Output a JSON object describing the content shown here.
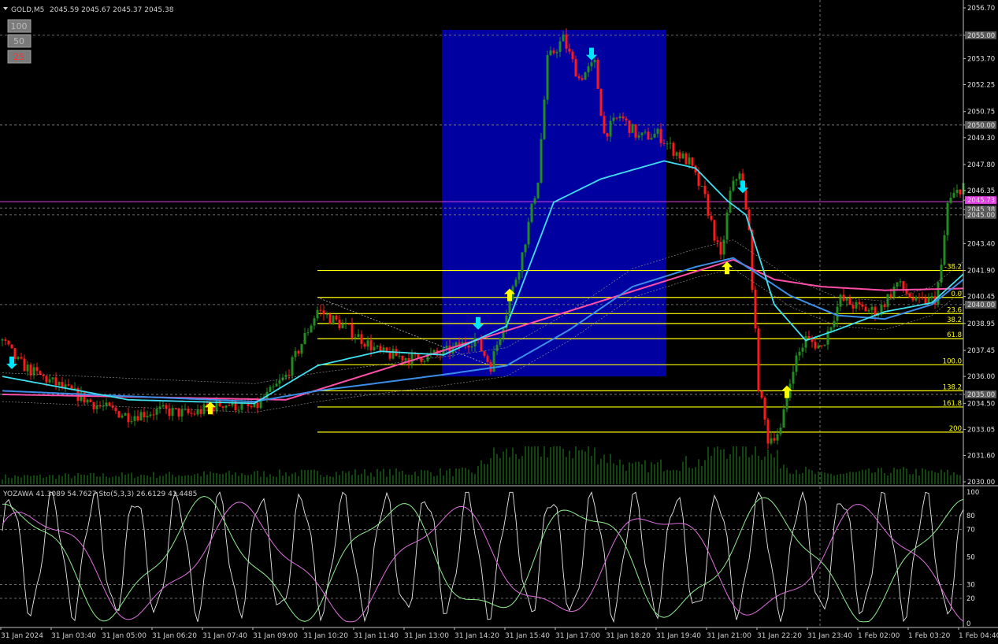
{
  "main_header": {
    "symbol": "GOLD,M5",
    "ohlc": "2045.59 2045.67 2045.37 2045.38"
  },
  "zoom_buttons": [
    {
      "label": "100"
    },
    {
      "label": "50"
    },
    {
      "label": "25"
    }
  ],
  "sub_header": {
    "text": "YOZAWA 41.3089 54.7627  Sto(5,3,3) 26.6129 41.4485"
  },
  "colors": {
    "bull": "#228b22",
    "bear": "#ff1a1a",
    "ma_fast": "#40e0f0",
    "ma_mid": "#3a8ee8",
    "ma_slow": "#ff4fa8",
    "fib": "#ffff00",
    "box": "#0000a0",
    "current": "#e040e0",
    "arrow_up": "#ffff00",
    "arrow_down": "#00e5ff"
  },
  "chart_data": {
    "type": "candlestick",
    "price_axis": {
      "min": 2030.0,
      "max": 2056.7,
      "ticks": [
        "2056.70",
        "2055.00",
        "2053.70",
        "2052.25",
        "2050.75",
        "2050.00",
        "2049.30",
        "2047.80",
        "2046.35",
        "2045.73",
        "2045.38",
        "2045.00",
        "2043.40",
        "2041.90",
        "2040.45",
        "2040.00",
        "2038.95",
        "2037.45",
        "2036.00",
        "2035.00",
        "2034.50",
        "2033.05",
        "2031.60",
        "2030.00"
      ],
      "highlight_ticks": [
        "2055.00",
        "2050.00",
        "2045.73",
        "2045.38",
        "2045.00",
        "2040.00",
        "2035.00"
      ]
    },
    "time_labels": [
      "31 Jan 2024",
      "31 Jan 03:40",
      "31 Jan 05:00",
      "31 Jan 06:20",
      "31 Jan 07:40",
      "31 Jan 09:00",
      "31 Jan 10:20",
      "31 Jan 11:40",
      "31 Jan 13:00",
      "31 Jan 14:20",
      "31 Jan 15:40",
      "31 Jan 17:00",
      "31 Jan 18:20",
      "31 Jan 19:40",
      "31 Jan 21:00",
      "31 Jan 22:20",
      "31 Jan 23:40",
      "1 Feb 02:00",
      "1 Feb 03:20",
      "1 Feb 04:40"
    ],
    "price_anchors": [
      [
        0,
        2038.0
      ],
      [
        5,
        2036.8
      ],
      [
        10,
        2036.2
      ],
      [
        20,
        2035.3
      ],
      [
        30,
        2034.4
      ],
      [
        40,
        2033.8
      ],
      [
        50,
        2034.1
      ],
      [
        60,
        2033.9
      ],
      [
        70,
        2034.5
      ],
      [
        80,
        2034.2
      ],
      [
        90,
        2036.0
      ],
      [
        100,
        2039.7
      ],
      [
        110,
        2038.6
      ],
      [
        120,
        2037.3
      ],
      [
        130,
        2037.0
      ],
      [
        140,
        2037.3
      ],
      [
        150,
        2038.1
      ],
      [
        155,
        2036.6
      ],
      [
        160,
        2039.6
      ],
      [
        165,
        2042.8
      ],
      [
        170,
        2047.0
      ],
      [
        173,
        2053.6
      ],
      [
        178,
        2054.8
      ],
      [
        183,
        2052.6
      ],
      [
        188,
        2053.4
      ],
      [
        191,
        2049.5
      ],
      [
        196,
        2050.5
      ],
      [
        202,
        2049.3
      ],
      [
        208,
        2049.5
      ],
      [
        213,
        2048.6
      ],
      [
        218,
        2047.9
      ],
      [
        223,
        2045.9
      ],
      [
        228,
        2042.5
      ],
      [
        231,
        2046.2
      ],
      [
        234,
        2047.5
      ],
      [
        237,
        2044.0
      ],
      [
        240,
        2035.5
      ],
      [
        243,
        2032.5
      ],
      [
        247,
        2033.0
      ],
      [
        251,
        2036.6
      ],
      [
        255,
        2038.1
      ],
      [
        260,
        2037.6
      ],
      [
        266,
        2040.3
      ],
      [
        272,
        2039.8
      ],
      [
        278,
        2039.6
      ],
      [
        284,
        2041.2
      ],
      [
        290,
        2040.1
      ],
      [
        296,
        2040.3
      ],
      [
        298,
        2042.0
      ],
      [
        300,
        2045.6
      ],
      [
        305,
        2046.7
      ]
    ],
    "ma_fast": [
      [
        0,
        2036.0
      ],
      [
        40,
        2034.7
      ],
      [
        80,
        2034.5
      ],
      [
        100,
        2036.6
      ],
      [
        120,
        2037.4
      ],
      [
        140,
        2037.2
      ],
      [
        160,
        2038.8
      ],
      [
        175,
        2045.7
      ],
      [
        190,
        2047.0
      ],
      [
        210,
        2048.0
      ],
      [
        220,
        2047.6
      ],
      [
        230,
        2045.8
      ],
      [
        236,
        2045.0
      ],
      [
        245,
        2040.0
      ],
      [
        255,
        2038.0
      ],
      [
        265,
        2038.6
      ],
      [
        280,
        2039.6
      ],
      [
        295,
        2040.1
      ],
      [
        305,
        2041.7
      ]
    ],
    "ma_mid": [
      [
        0,
        2035.2
      ],
      [
        40,
        2034.9
      ],
      [
        80,
        2034.6
      ],
      [
        100,
        2035.2
      ],
      [
        140,
        2036.1
      ],
      [
        160,
        2036.6
      ],
      [
        180,
        2038.6
      ],
      [
        200,
        2041.0
      ],
      [
        220,
        2042.1
      ],
      [
        232,
        2042.6
      ],
      [
        250,
        2040.5
      ],
      [
        265,
        2039.4
      ],
      [
        280,
        2039.2
      ],
      [
        295,
        2040.0
      ],
      [
        305,
        2041.4
      ]
    ],
    "ma_slow": [
      [
        0,
        2035.0
      ],
      [
        60,
        2034.8
      ],
      [
        90,
        2034.7
      ],
      [
        232,
        2042.5
      ],
      [
        245,
        2041.4
      ],
      [
        260,
        2041.0
      ],
      [
        280,
        2040.8
      ],
      [
        305,
        2040.9
      ]
    ],
    "fib_levels": [
      {
        "label": "-38.2",
        "price": 2041.9
      },
      {
        "label": "0.0",
        "price": 2040.4
      },
      {
        "label": "23.6",
        "price": 2039.5
      },
      {
        "label": "38.2",
        "price": 2038.95
      },
      {
        "label": "61.8",
        "price": 2038.1
      },
      {
        "label": "100.0",
        "price": 2036.65
      },
      {
        "label": "138.2",
        "price": 2035.2
      },
      {
        "label": "161.8",
        "price": 2034.3
      },
      {
        "label": "200",
        "price": 2032.9
      }
    ],
    "fib_start_bar": 100,
    "highlight_box": {
      "bar_start": 140,
      "bar_end": 211,
      "price_top": 2055.3,
      "price_bottom": 2036.0
    },
    "current_price": 2045.73,
    "signals": [
      {
        "type": "down",
        "bar": 3,
        "price": 2036.8
      },
      {
        "type": "up",
        "bar": 66,
        "price": 2034.2
      },
      {
        "type": "down",
        "bar": 151,
        "price": 2039.0
      },
      {
        "type": "up",
        "bar": 161,
        "price": 2040.5
      },
      {
        "type": "down",
        "bar": 187,
        "price": 2054.0
      },
      {
        "type": "up",
        "bar": 230,
        "price": 2042.0
      },
      {
        "type": "down",
        "bar": 235,
        "price": 2046.6
      },
      {
        "type": "up",
        "bar": 249,
        "price": 2035.1
      }
    ],
    "volume_anchors": [
      [
        0,
        0.2
      ],
      [
        100,
        0.3
      ],
      [
        150,
        0.33
      ],
      [
        155,
        0.75
      ],
      [
        175,
        1.0
      ],
      [
        190,
        0.8
      ],
      [
        200,
        0.45
      ],
      [
        222,
        0.6
      ],
      [
        228,
        1.0
      ],
      [
        240,
        1.0
      ],
      [
        250,
        0.45
      ],
      [
        260,
        0.25
      ],
      [
        285,
        0.35
      ],
      [
        300,
        0.3
      ],
      [
        305,
        0.25
      ]
    ],
    "oscillator": {
      "ylim": [
        0,
        100
      ],
      "levels": [
        "100",
        "80",
        "70",
        "50",
        "30",
        "20",
        "0"
      ],
      "dashed": [
        80,
        70,
        30,
        20
      ]
    }
  }
}
